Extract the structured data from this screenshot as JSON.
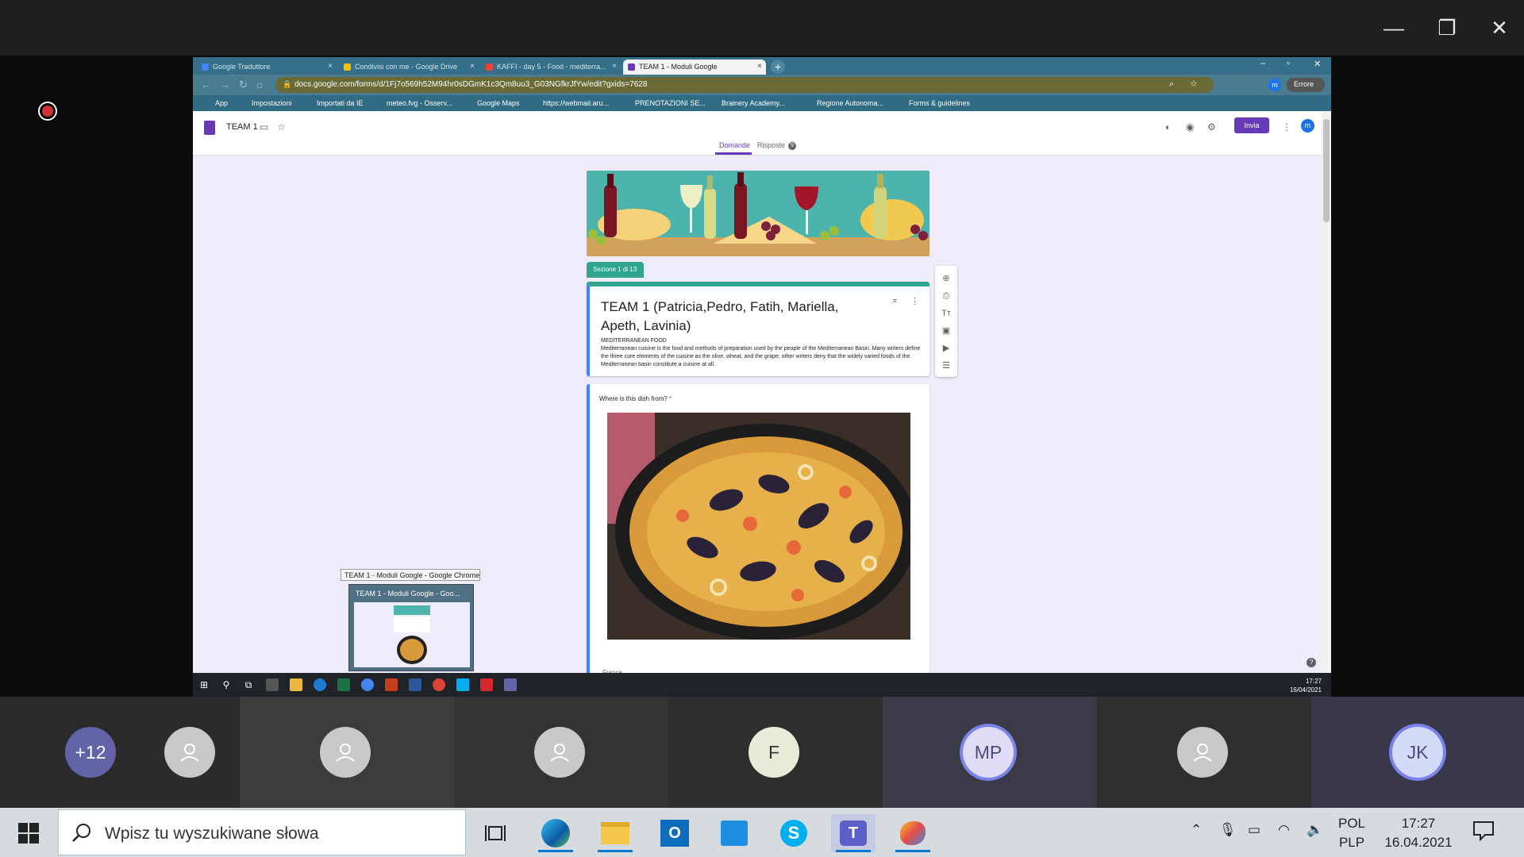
{
  "teams": {
    "window_controls": {
      "minimize": "—",
      "maximize": "❐",
      "close": "✕"
    }
  },
  "browser": {
    "tabs": [
      {
        "label": "Google Traduttore",
        "close": "×",
        "color": "#4285f4"
      },
      {
        "label": "Condivisi con me - Google Drive",
        "close": "×",
        "color": "#fbbc04"
      },
      {
        "label": "KAFFI - day 5 - Food - mediterra...",
        "close": "×",
        "color": "#ea4335"
      },
      {
        "label": "TEAM 1 - Moduli Google",
        "close": "×",
        "color": "#673ab7"
      }
    ],
    "new_tab": "+",
    "window_controls": {
      "minimize": "–",
      "maximize": "▫",
      "close": "✕"
    },
    "url": "docs.google.com/forms/d/1Fj7o569h52M94hr0sDGmK1c3Qm8uu3_G03NGfkrJfYw/edit?gxids=7628",
    "profile_letter": "m",
    "error_label": "Errore",
    "bookmarks": [
      "App",
      "Impostazioni",
      "Importati da IE",
      "meteo.fvg - Osserv...",
      "Google Maps",
      "https://webmail.aru...",
      "PRENOTAZIONI SE...",
      "Brainery Academy...",
      "Regione Autonoma...",
      "Forms & guidelines"
    ]
  },
  "form": {
    "doc_name": "TEAM 1",
    "send_label": "Invia",
    "avatar_letter": "m",
    "tabs": {
      "questions": "Domande",
      "responses": "Risposte",
      "responses_count": "9"
    },
    "section_label": "Sezione 1 di 13",
    "title": "TEAM 1 (Patricia,Pedro, Fatih, Mariella, Apeth, Lavinia)",
    "subtitle": "MEDITERRANEAN FOOD",
    "description": "Mediterranean cuisine is the food and methods of preparation used by the people of the Mediterranean Basin. Many writers define the three core elements of the cuisine as the olive, wheat, and the grape; other writers deny that the widely varied foods of the Mediterranean basin constitute a cuisine at all.",
    "question": "Where is this dish from?",
    "required_mark": "*",
    "option_1": "France",
    "help": "?"
  },
  "preview": {
    "tooltip": "TEAM 1 - Moduli Google - Google Chrome",
    "title": "TEAM 1 - Moduli Google - Goo..."
  },
  "inner_taskbar": {
    "time": "17:27",
    "date": "16/04/2021"
  },
  "participants": [
    {
      "label": "+12",
      "bg": "#6264a7"
    },
    {
      "label": "",
      "bg": "#c8c8c8"
    },
    {
      "label": "",
      "bg": "#c8c8c8"
    },
    {
      "label": "",
      "bg": "#c8c8c8"
    },
    {
      "label": "F",
      "bg": "#e8ebd8"
    },
    {
      "label": "MP",
      "bg": "#e1dcf6"
    },
    {
      "label": "",
      "bg": "#c8c8c8"
    },
    {
      "label": "JK",
      "bg": "#d4dbf7"
    }
  ],
  "windows_taskbar": {
    "search_placeholder": "Wpisz tu wyszukiwane słowa",
    "language": "POL",
    "layout": "PLP",
    "time": "17:27",
    "date": "16.04.2021"
  }
}
